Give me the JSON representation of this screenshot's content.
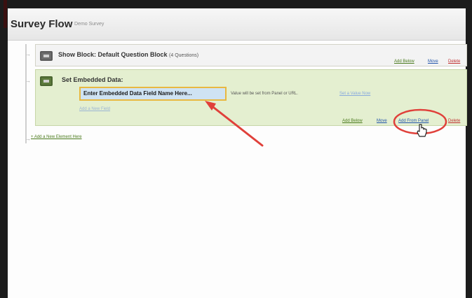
{
  "header": {
    "title": "Survey Flow",
    "subtitle": "Demo Survey"
  },
  "blocks": {
    "show_block": {
      "title": "Show Block: Default Question Block",
      "count": "(4 Questions)",
      "actions": {
        "add_below": "Add Below",
        "move": "Move",
        "delete": "Delete"
      }
    },
    "embedded_data": {
      "title": "Set Embedded Data:",
      "field_placeholder": "Enter Embedded Data Field Name Here...",
      "value_note": "Value will be set from Panel or URL.",
      "set_value_link": "Set a Value Now",
      "add_field": "Add a New Field",
      "actions": {
        "add_below": "Add Below",
        "move": "Move",
        "add_from_panel": "Add From Panel",
        "delete": "Delete"
      }
    }
  },
  "add_element": "+ Add a New Element Here",
  "colors": {
    "annotation": "#e0403a",
    "embedded_bg": "#e4efd0",
    "input_highlight": "#cfe3f3"
  },
  "icons": [
    "block-icon",
    "embedded-data-icon",
    "flow-arrow-icon",
    "hand-pointer-icon"
  ]
}
